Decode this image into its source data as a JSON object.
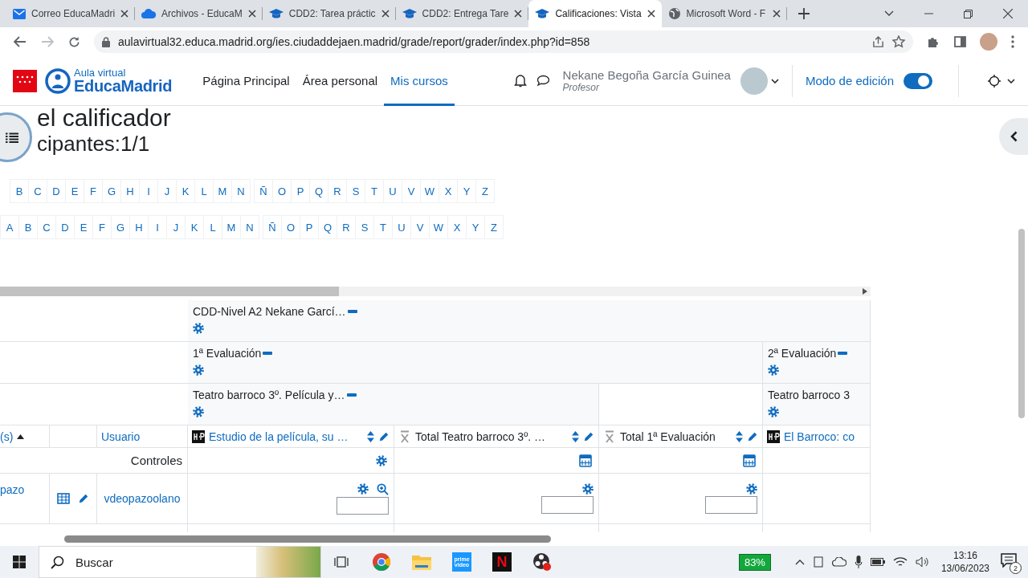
{
  "browser": {
    "tabs": [
      {
        "title": "Correo EducaMadri",
        "kind": "mail",
        "selected": false
      },
      {
        "title": "Archivos - EducaM",
        "kind": "cloud",
        "selected": false
      },
      {
        "title": "CDD2: Tarea práctic",
        "kind": "course",
        "selected": false
      },
      {
        "title": "CDD2: Entrega Tare",
        "kind": "course",
        "selected": false
      },
      {
        "title": "Calificaciones: Vista",
        "kind": "course",
        "selected": true
      },
      {
        "title": "Microsoft Word - F",
        "kind": "web",
        "selected": false
      }
    ],
    "url": "aulavirtual32.educa.madrid.org/ies.ciudaddejaen.madrid/grade/report/grader/index.php?id=858"
  },
  "site": {
    "logo_small": "Aula virtual",
    "logo_big": "EducaMadrid",
    "nav": [
      {
        "label": "Página Principal",
        "selected": false
      },
      {
        "label": "Área personal",
        "selected": false
      },
      {
        "label": "Mis cursos",
        "selected": true
      }
    ],
    "user": {
      "name": "Nekane Begoña García Guinea",
      "role": "Profesor"
    },
    "edit_mode": {
      "label": "Modo de edición",
      "on": true
    }
  },
  "page": {
    "title": "el calificador",
    "participants": "cipantes:1/1",
    "first_name_initials": [
      "B",
      "C",
      "D",
      "E",
      "F",
      "G",
      "H",
      "I",
      "J",
      "K",
      "L",
      "M",
      "N",
      "Ñ",
      "O",
      "P",
      "Q",
      "R",
      "S",
      "T",
      "U",
      "V",
      "W",
      "X",
      "Y",
      "Z"
    ],
    "last_name_initials": [
      "A",
      "B",
      "C",
      "D",
      "E",
      "F",
      "G",
      "H",
      "I",
      "J",
      "K",
      "L",
      "M",
      "N",
      "Ñ",
      "O",
      "P",
      "Q",
      "R",
      "S",
      "T",
      "U",
      "V",
      "W",
      "X",
      "Y",
      "Z"
    ]
  },
  "grader": {
    "course_category": "CDD-Nivel A2 Nekane Garcí…",
    "evaluations": [
      "1ª Evaluación",
      "2ª Evaluación"
    ],
    "subcategories": [
      "Teatro barroco 3º. Película y…",
      "Teatro barroco 3"
    ],
    "name_header": "(s)",
    "user_header": "Usuario",
    "controls_label": "Controles",
    "items": [
      {
        "kind": "h5p",
        "label": "Estudio de la película, su …",
        "partial": false
      },
      {
        "kind": "total",
        "label": "Total Teatro barroco 3º. …",
        "partial": false
      },
      {
        "kind": "total",
        "label": "Total 1ª Evaluación",
        "partial": false
      },
      {
        "kind": "h5p",
        "label": "El Barroco: co",
        "partial": true
      }
    ],
    "student": {
      "name": "pazo",
      "username": "vdeopazoolano"
    }
  },
  "taskbar": {
    "search_placeholder": "Buscar",
    "prime_label": "prime video",
    "netflix_letter": "N",
    "battery": "83%",
    "time": "13:16",
    "date": "13/06/2023",
    "notifications": "2"
  }
}
